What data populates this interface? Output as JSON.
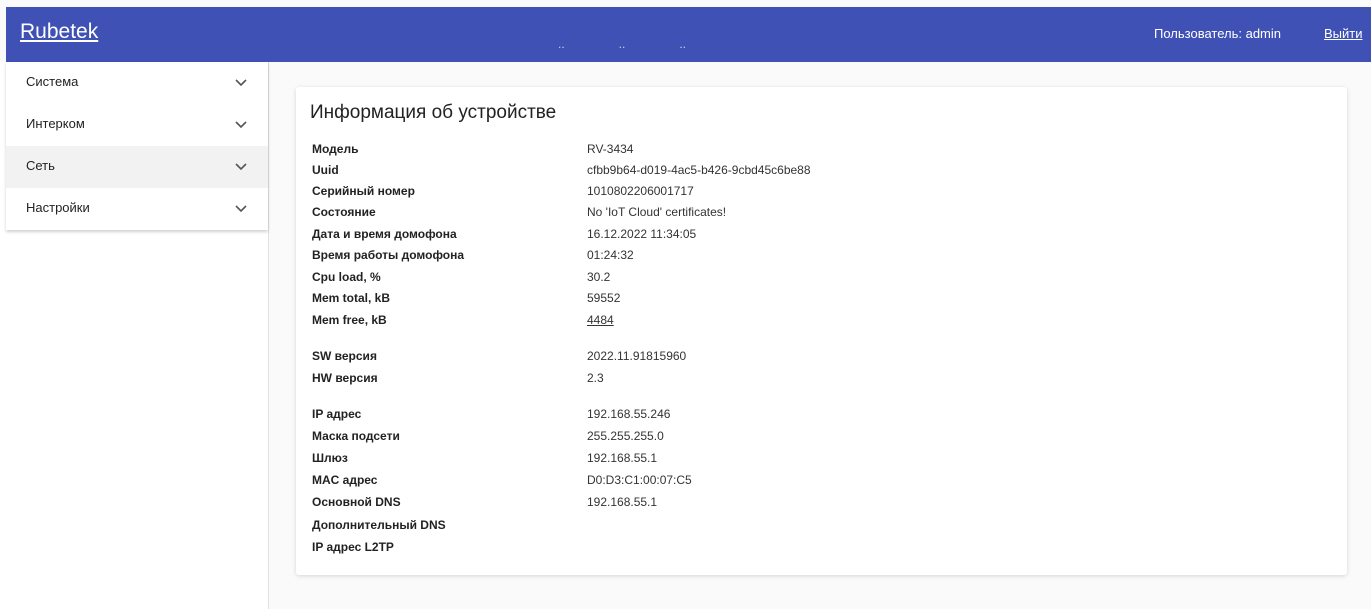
{
  "header": {
    "brand": "Rubetek",
    "nav_dots": [
      "..",
      "..",
      ".."
    ],
    "user_label": "Пользователь: admin",
    "logout": "Выйти",
    "color": "#3f51b5"
  },
  "sidebar": {
    "items": [
      {
        "label": "Система",
        "icon": "chevron-down-icon"
      },
      {
        "label": "Интерком",
        "icon": "chevron-down-icon"
      },
      {
        "label": "Сеть",
        "icon": "chevron-down-icon",
        "active": true
      },
      {
        "label": "Настройки",
        "icon": "chevron-down-icon"
      }
    ]
  },
  "device_info": {
    "title": "Информация об устройстве",
    "rows": [
      {
        "label": "Модель",
        "value": "RV-3434"
      },
      {
        "label": "Uuid",
        "value": "cfbb9b64-d019-4ac5-b426-9cbd45c6be88"
      },
      {
        "label": "Серийный номер",
        "value": "1010802206001717"
      },
      {
        "label": "Состояние",
        "value": "No 'IoT Cloud' certificates!"
      },
      {
        "label": "Дата и время домофона",
        "value": "16.12.2022 11:34:05"
      },
      {
        "label": "Время работы домофона",
        "value": "01:24:32"
      },
      {
        "label": "Cpu load, %",
        "value": "30.2"
      },
      {
        "label": "Mem total, kB",
        "value": "59552"
      },
      {
        "label": "Mem free, kB",
        "value": "4484"
      },
      {
        "label": "SW версия",
        "value": "2022.11.91815960"
      },
      {
        "label": "HW версия",
        "value": "2.3"
      },
      {
        "label": "IP адрес",
        "value": "192.168.55.246"
      },
      {
        "label": "Маска подсети",
        "value": "255.255.255.0"
      },
      {
        "label": "Шлюз",
        "value": "192.168.55.1"
      },
      {
        "label": "MAC адрес",
        "value": "D0:D3:C1:00:07:C5"
      },
      {
        "label": "Основной DNS",
        "value": "192.168.55.1"
      },
      {
        "label": "Дополнительный DNS",
        "value": ""
      },
      {
        "label": "IP адрес L2TP",
        "value": ""
      }
    ]
  }
}
